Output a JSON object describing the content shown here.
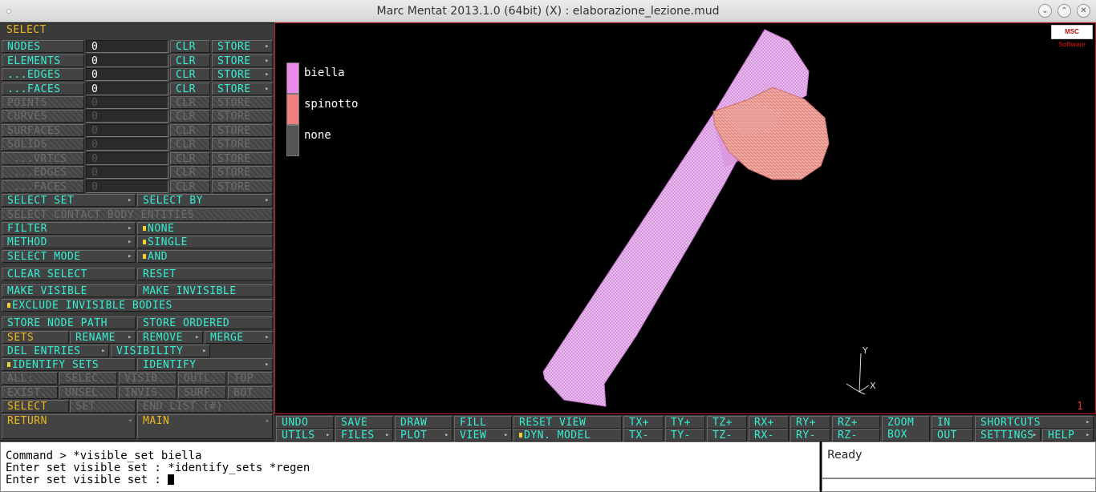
{
  "window": {
    "title": "Marc Mentat 2013.1.0 (64bit) (X) : elaborazione_lezione.mud"
  },
  "left_panel": {
    "header": "SELECT",
    "rows": [
      {
        "label": "NODES",
        "value": "0"
      },
      {
        "label": "ELEMENTS",
        "value": "0"
      },
      {
        "label": "...EDGES",
        "value": "0"
      },
      {
        "label": "...FACES",
        "value": "0"
      }
    ],
    "disabled_rows": [
      {
        "label": "POINTS",
        "value": "0"
      },
      {
        "label": "CURVES",
        "value": "0"
      },
      {
        "label": "SURFACES",
        "value": "0"
      },
      {
        "label": "SOLIDS",
        "value": "0"
      },
      {
        "label": "...VRTCS",
        "value": "0"
      },
      {
        "label": "...EDGES",
        "value": "0"
      },
      {
        "label": "...FACES",
        "value": "0"
      }
    ],
    "clr": "CLR",
    "store": "STORE",
    "select_set": "SELECT SET",
    "select_by": "SELECT BY",
    "select_contact": "SELECT CONTACT BODY ENTITIES",
    "filter": "FILTER",
    "filter_value": "NONE",
    "method": "METHOD",
    "method_value": "SINGLE",
    "select_mode": "SELECT MODE",
    "select_mode_value": "AND",
    "clear_select": "CLEAR SELECT",
    "reset": "RESET",
    "make_visible": "MAKE VISIBLE",
    "make_invisible": "MAKE INVISIBLE",
    "exclude_invisible": "EXCLUDE INVISIBLE BODIES",
    "store_node_path": "STORE NODE PATH",
    "store_ordered": "STORE ORDERED",
    "sets": "SETS",
    "rename": "RENAME",
    "remove": "REMOVE",
    "merge": "MERGE",
    "del_entries": "DEL ENTRIES",
    "visibility": "VISIBILITY",
    "identify_sets": "IDENTIFY SETS",
    "identify": "IDENTIFY",
    "grid1": [
      "ALL:",
      "SELEC.",
      "VISIB.",
      "OUTL.",
      "TOP"
    ],
    "grid2": [
      "EXIST.",
      "UNSEL.",
      "INVIS.",
      "SURF.",
      "BOT"
    ],
    "select2": "SELECT",
    "set": "SET",
    "end_list": "END LIST (#)",
    "return": "RETURN",
    "main": "MAIN"
  },
  "viewport": {
    "logo": "MSC Software",
    "legend": [
      {
        "label": "biella",
        "color": "#e88ae8"
      },
      {
        "label": "spinotto",
        "color": "#f08080"
      },
      {
        "label": "none",
        "color": "#555555"
      }
    ],
    "axis_y": "Y",
    "axis_x": "X",
    "viewport_number": "1"
  },
  "bottom_bar": {
    "row1": [
      "UNDO",
      "SAVE",
      "DRAW",
      "FILL",
      "RESET VIEW",
      "TX+",
      "TY+",
      "TZ+",
      "RX+",
      "RY+",
      "RZ+"
    ],
    "row2": [
      "UTILS",
      "FILES",
      "PLOT",
      "VIEW",
      "DYN. MODEL",
      "TX-",
      "TY-",
      "TZ-",
      "RX-",
      "RY-",
      "RZ-"
    ],
    "zoom": "ZOOM",
    "box": "BOX",
    "in": "IN",
    "out": "OUT",
    "shortcuts": "SHORTCUTS",
    "settings": "SETTINGS",
    "help": "HELP"
  },
  "command": {
    "line1": "Command > *visible_set biella",
    "line2": "Enter set visible set : *identify_sets *regen",
    "line3": "Enter set visible set : "
  },
  "status": {
    "text": "Ready"
  }
}
